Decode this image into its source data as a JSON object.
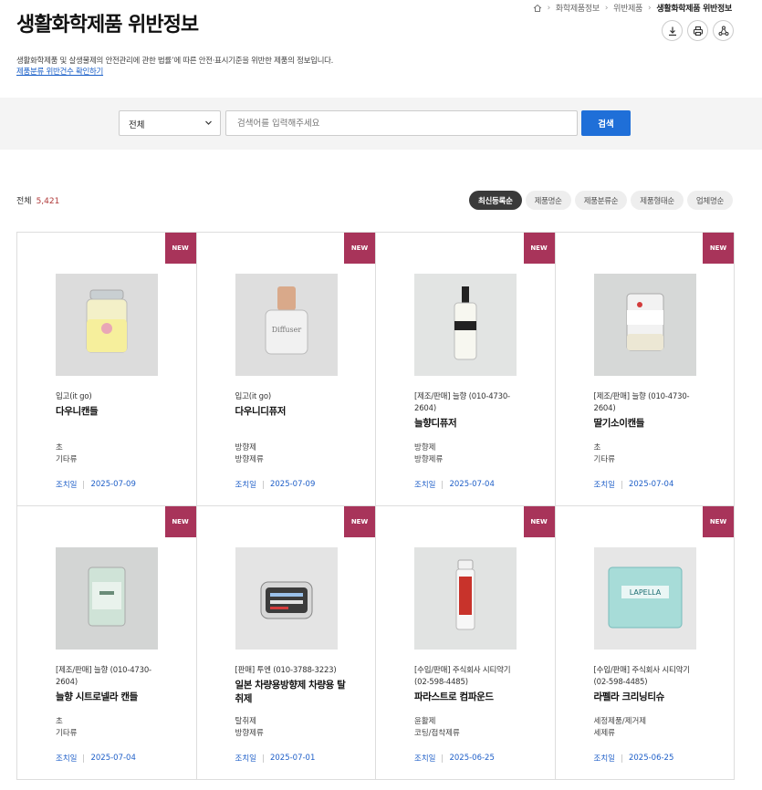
{
  "page": {
    "title": "생활화학제품 위반정보",
    "description": "생활화학제품 및 살생물제의 안전관리에 관한 법률’에 따른 안전·표시기준을 위반한 제품의 정보입니다.",
    "link_text": "제품분류 위반건수 확인하기"
  },
  "breadcrumb": [
    "화학제품정보",
    "위반제품",
    "생활화학제품 위반정보"
  ],
  "tools": [
    "download-icon",
    "print-icon",
    "share-icon"
  ],
  "search": {
    "select_value": "전체",
    "placeholder": "검색어를 입력해주세요",
    "button": "검색"
  },
  "summary": {
    "label": "전체",
    "count": "5,421"
  },
  "sort_options": [
    "최신등록순",
    "제품명순",
    "제품분류순",
    "제품형태순",
    "업체명순"
  ],
  "active_sort": "최신등록순",
  "measure_label": "조치일",
  "products": [
    {
      "badge": "NEW",
      "maker": "입고(it go)",
      "name": "다우니캔들",
      "cat1": "초",
      "cat2": "기타류",
      "date": "2025-07-09"
    },
    {
      "badge": "NEW",
      "maker": "입고(it go)",
      "name": "다우니디퓨저",
      "cat1": "방향제",
      "cat2": "방향제류",
      "date": "2025-07-09"
    },
    {
      "badge": "NEW",
      "maker": "[제조/판매] 늘향 (010-4730-2604)",
      "name": "늘향디퓨저",
      "cat1": "방향제",
      "cat2": "방향제류",
      "date": "2025-07-04"
    },
    {
      "badge": "NEW",
      "maker": "[제조/판매] 늘향 (010-4730-2604)",
      "name": "딸기소이캔들",
      "cat1": "초",
      "cat2": "기타류",
      "date": "2025-07-04"
    },
    {
      "badge": "NEW",
      "maker": "[제조/판매] 늘향 (010-4730-2604)",
      "name": "늘향 시트로넬라 캔들",
      "cat1": "초",
      "cat2": "기타류",
      "date": "2025-07-04"
    },
    {
      "badge": "NEW",
      "maker": "[판매] 투엔 (010-3788-3223)",
      "name": "일본 차량용방향제 차량용 탈취제",
      "cat1": "탈취제",
      "cat2": "방향제류",
      "date": "2025-07-01"
    },
    {
      "badge": "NEW",
      "maker": "[수입/판매] 주식회사 시티약기 (02-598-4485)",
      "name": "파라스트로 컴파운드",
      "cat1": "윤활제",
      "cat2": "코팅/접착제류",
      "date": "2025-06-25"
    },
    {
      "badge": "NEW",
      "maker": "[수입/판매] 주식회사 시티약기 (02-598-4485)",
      "name": "라펠라 크리닝티슈",
      "cat1": "세정제품/제거제",
      "cat2": "세제류",
      "date": "2025-06-25"
    }
  ]
}
